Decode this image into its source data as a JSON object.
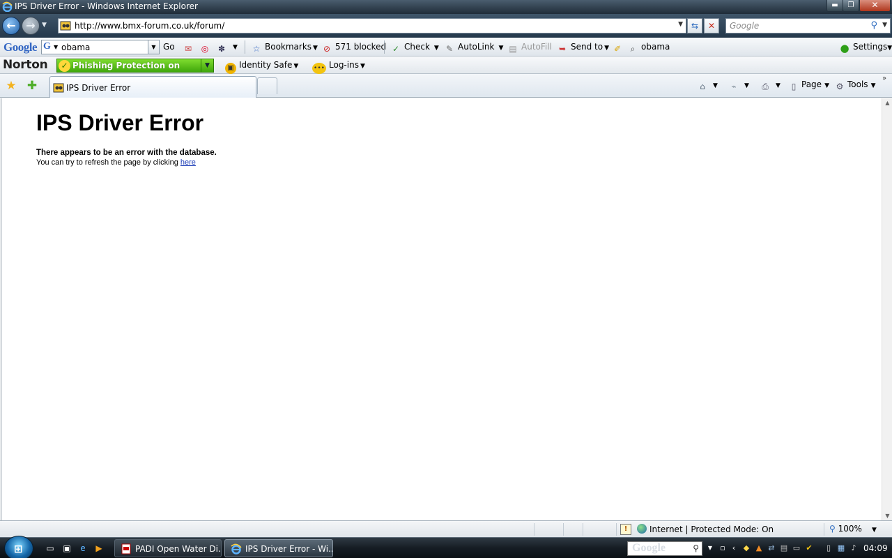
{
  "window": {
    "title": "IPS Driver Error - Windows Internet Explorer",
    "minimize_glyph": "▬",
    "maximize_glyph": "❐",
    "close_glyph": "✕"
  },
  "address_bar": {
    "url": "http://www.bmx-forum.co.uk/forum/",
    "search_placeholder": "Google"
  },
  "google_toolbar": {
    "logo": "Google",
    "query": "obama",
    "go_label": "Go",
    "bookmarks_label": "Bookmarks",
    "blocked_label": "571 blocked",
    "check_label": "Check",
    "autolink_label": "AutoLink",
    "autofill_label": "AutoFill",
    "sendto_label": "Send to",
    "highlight_term": "obama",
    "settings_label": "Settings"
  },
  "norton_toolbar": {
    "logo": "Norton",
    "phishing_label": "Phishing Protection on",
    "identity_label": "Identity Safe",
    "logins_label": "Log-ins"
  },
  "tabs": [
    {
      "label": "IPS Driver Error",
      "active": true
    }
  ],
  "command_bar": {
    "page_label": "Page",
    "tools_label": "Tools"
  },
  "page": {
    "heading": "IPS Driver Error",
    "message_strong": "There appears to be an error with the database.",
    "message_prefix": "You can try to refresh the page by clicking ",
    "message_link": "here"
  },
  "status_bar": {
    "zone": "Internet | Protected Mode: On",
    "zoom": "100%"
  },
  "taskbar": {
    "tasks": [
      {
        "label": "PADI Open Water Di...",
        "icon": "pdf-icon"
      },
      {
        "label": "IPS Driver Error - Wi...",
        "icon": "ie-icon"
      }
    ],
    "tray_search_text": "Google",
    "clock": "04:09"
  },
  "colors": {
    "phishing_green": "#4cb814",
    "link_blue": "#1f3fb8",
    "title_bar": "#2b3a48"
  }
}
